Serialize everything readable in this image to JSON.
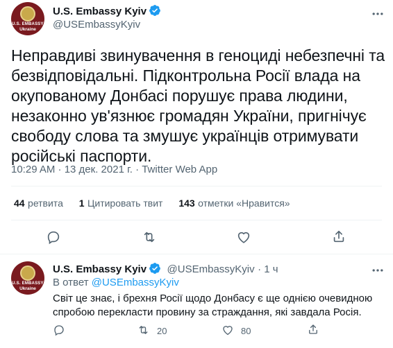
{
  "main_tweet": {
    "author_name": "U.S. Embassy Kyiv",
    "author_handle": "@USEmbassyKyiv",
    "avatar_caption_1": "U.S. EMBASSY",
    "avatar_caption_2": "Ukraine",
    "text_lines": [
      "Неправдиві звинувачення в геноциді небезпечні та",
      "безвідповідальні. Підконтрольна Росії влада на",
      "окупованому Донбасі порушує права людини,",
      "незаконно ув'язнює громадян України, пригнічує",
      "свободу слова та змушує українців отримувати",
      "російські паспорти."
    ],
    "timestamp": "10:29 AM · 13 дек. 2021 г. · Twitter Web App",
    "stats": {
      "retweets_num": "44",
      "retweets_label": "ретвита",
      "quotes_num": "1",
      "quotes_label": "Цитировать твит",
      "likes_num": "143",
      "likes_label": "отметки «Нравится»"
    }
  },
  "reply_tweet": {
    "author_name": "U.S. Embassy Kyiv",
    "author_handle": "@USEmbassyKyiv",
    "time_ago": "· 1 ч",
    "reply_prefix": "В ответ",
    "reply_to": "@USEmbassyKyiv",
    "text_lines": [
      "Світ це знає, і брехня Росії щодо Донбасу є ще однією очевидною",
      "спробою перекласти провину за страждання, які завдала Росія."
    ],
    "retweet_count": "20",
    "like_count": "80"
  },
  "colors": {
    "accent": "#1d9bf0",
    "muted": "#536471",
    "text": "#0f1419",
    "divider": "#eff3f4"
  },
  "icons": [
    "verified-badge-icon",
    "more-icon",
    "reply-icon",
    "retweet-icon",
    "like-icon",
    "share-icon"
  ]
}
